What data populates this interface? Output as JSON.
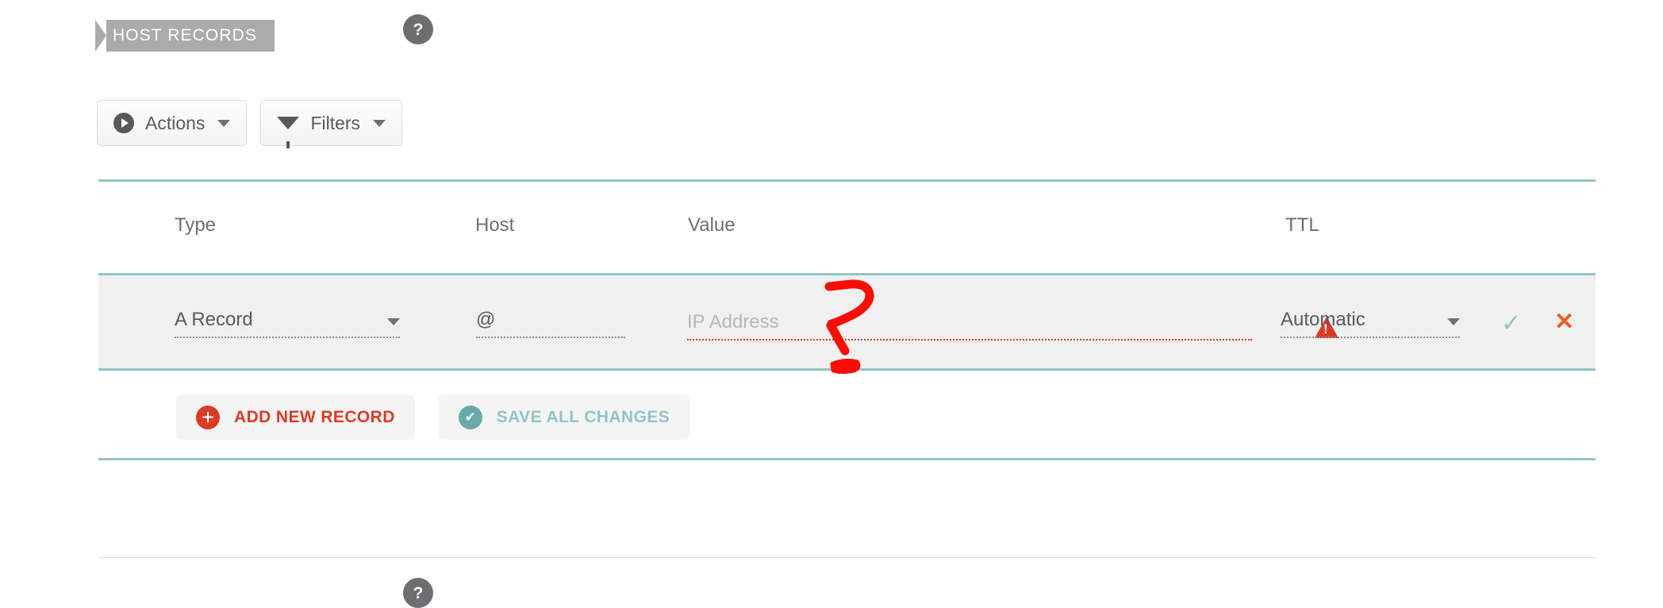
{
  "section": {
    "title": "HOST RECORDS",
    "ribbon_color": "#ababab",
    "help_icon": "question-mark-icon",
    "help_label": "?"
  },
  "toolbar": {
    "actions": {
      "label": "Actions",
      "icon": "play-circle-icon",
      "caret": "chevron-down-icon"
    },
    "filters": {
      "label": "Filters",
      "icon": "funnel-icon",
      "caret": "chevron-down-icon"
    }
  },
  "table": {
    "accent_color": "#93c4c6",
    "headers": {
      "type": "Type",
      "host": "Host",
      "value": "Value",
      "ttl": "TTL"
    },
    "row": {
      "type_value": "A Record",
      "host_value": "@",
      "value_placeholder": "IP Address",
      "value_value": "",
      "value_has_error": true,
      "error_color": "#e03a27",
      "ttl_value": "Automatic",
      "warning_icon": "warning-triangle-icon",
      "warning_glyph": "!",
      "confirm_icon": "checkmark-icon",
      "confirm_glyph": "✓",
      "confirm_color": "#93c4c6",
      "cancel_icon": "close-x-icon",
      "cancel_glyph": "✕",
      "cancel_color": "#f15a22"
    }
  },
  "footer": {
    "add_record": {
      "label": "ADD NEW RECORD",
      "icon": "plus-circle-icon",
      "glyph": "+",
      "color": "#db3b26"
    },
    "save_changes": {
      "label": "SAVE ALL CHANGES",
      "icon": "check-circle-icon",
      "glyph": "✔",
      "color": "#93c4c6"
    }
  },
  "annotation": {
    "kind": "hand-drawn-question-mark",
    "color": "#fb0c04",
    "note": "?"
  },
  "bottom": {
    "help_icon": "question-mark-icon"
  }
}
